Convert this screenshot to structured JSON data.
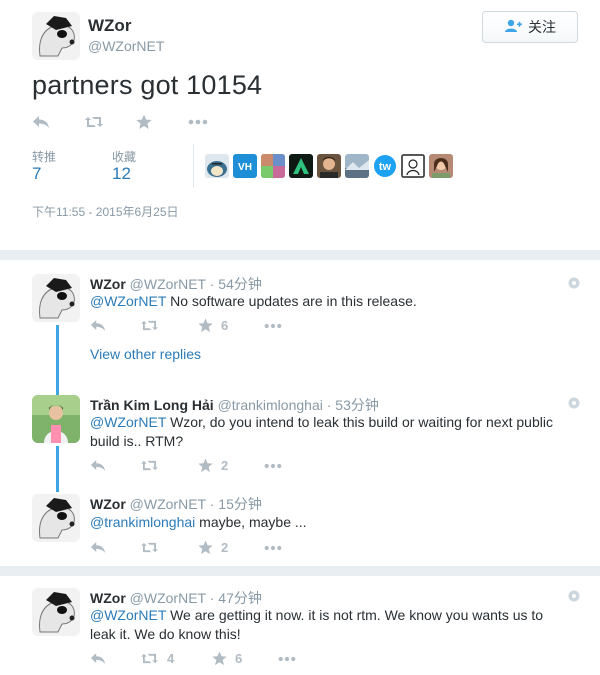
{
  "main": {
    "name": "WZor",
    "handle": "@WZorNET",
    "follow_label": "关注",
    "text": "partners got 10154",
    "retweets_label": "转推",
    "retweets_value": "7",
    "likes_label": "收藏",
    "likes_value": "12",
    "timestamp": "下午11:55 - 2015年6月25日"
  },
  "replies": [
    {
      "name": "WZor",
      "handle": "@WZorNET",
      "time": "· 54分钟",
      "mention": "@WZorNET",
      "text": " No software updates are in this release.",
      "likes": "6",
      "retweets": ""
    },
    {
      "name": "Trần Kim Long Hải",
      "handle": "@trankimlonghai",
      "time": "· 53分钟",
      "mention": "@WZorNET",
      "text": " Wzor, do you intend to leak this build or waiting for next public build is.. RTM?",
      "likes": "2",
      "retweets": ""
    },
    {
      "name": "WZor",
      "handle": "@WZorNET",
      "time": "· 15分钟",
      "mention": "@trankimlonghai",
      "text": " maybe, maybe ...",
      "likes": "2",
      "retweets": ""
    },
    {
      "name": "WZor",
      "handle": "@WZorNET",
      "time": "· 47分钟",
      "mention": "@WZorNET",
      "text": "  We are getting it now. it is not rtm. We know you wants us to leak it. We do know this!",
      "likes": "6",
      "retweets": "4"
    }
  ],
  "view_other_replies": "View other replies",
  "retweeter_avatars": [
    "snorlax",
    "VH",
    "photo-collage",
    "green-A",
    "face",
    "landscape",
    "tw",
    "sketch",
    "selfie"
  ],
  "colors": {
    "link": "#2b7bb9",
    "thread": "#3ea6e6",
    "icon": "#b1bbc3",
    "separator": "#e8eef2"
  }
}
